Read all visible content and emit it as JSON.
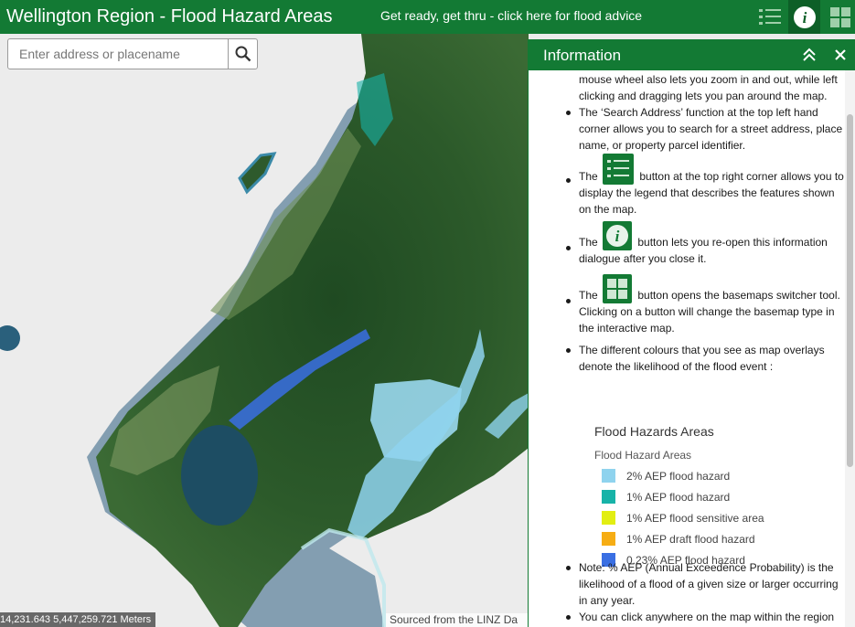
{
  "header": {
    "title": "Wellington Region - Flood Hazard Areas",
    "advice_link": "Get ready, get thru - click here for flood advice",
    "buttons": [
      {
        "name": "legend",
        "icon": "list-icon"
      },
      {
        "name": "info",
        "icon": "info-icon"
      },
      {
        "name": "basemap",
        "icon": "grid-icon"
      }
    ]
  },
  "search": {
    "placeholder": "Enter address or placename",
    "value": ""
  },
  "map": {
    "coordinates": "14,231.643 5,447,259.721 Meters",
    "attribution": "Sourced from the LINZ Da"
  },
  "panel": {
    "title": "Information",
    "paragraphs": {
      "p0": "mouse wheel also lets you zoom in and out, while left clicking and dragging lets you pan around the map.",
      "p1": "The ‘Search Address’ function at the top left hand corner allows you to search for a street address, place name, or property parcel identifier.",
      "p2_pre": "The",
      "p2_post": "button at the top right corner allows you to display the legend that describes the features shown on the map.",
      "p3_pre": "The",
      "p3_post": "button lets you re-open this information dialogue after you close it.",
      "p4_pre": "The",
      "p4_post": "button opens the basemaps switcher tool. Clicking on a button will change the basemap type in the interactive map.",
      "p5": "The different colours that you see as map overlays denote the likelihood of the flood event :",
      "p6": "Note:  % AEP (Annual Exceedence Probability) is the likelihood of a flood of a given size or larger occurring in any year.",
      "p7": "You can click anywhere on the map within the region"
    },
    "legend": {
      "title": "Flood Hazards Areas",
      "subtitle": "Flood Hazard Areas",
      "items": [
        {
          "label": "2% AEP flood hazard",
          "color": "#8fd3ee"
        },
        {
          "label": "1% AEP flood hazard",
          "color": "#17b3a8"
        },
        {
          "label": "1% AEP flood sensitive area",
          "color": "#e2ee12"
        },
        {
          "label": "1% AEP draft flood hazard",
          "color": "#f6ad14"
        },
        {
          "label": "0.23% AEP flood hazard",
          "color": "#3a6fe3"
        }
      ]
    }
  },
  "colors": {
    "brand_green": "#137a34",
    "brand_green_dark": "#0d5f27"
  }
}
